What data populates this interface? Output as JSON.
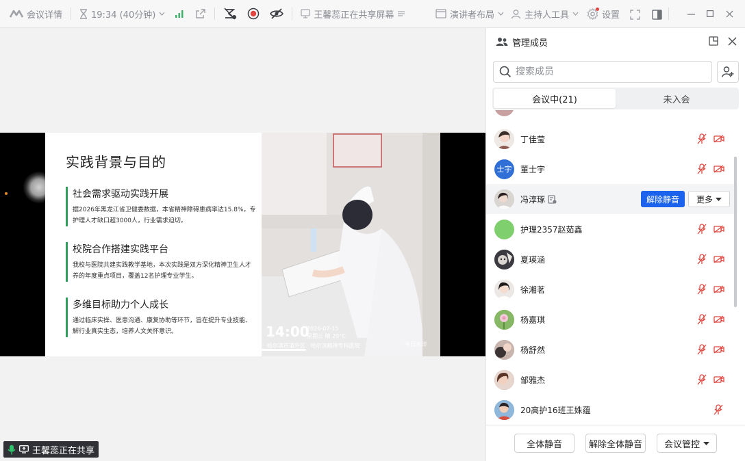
{
  "topbar": {
    "meeting_details": "会议详情",
    "duration": "19:34 (40分钟)",
    "sharer_status": "王馨蕊正在共享屏幕",
    "speaker_layout": "演讲者布局",
    "host_tools": "主持人工具",
    "settings": "设置"
  },
  "share": {
    "slide_title": "实践背景与目的",
    "sections": [
      {
        "heading": "社会需求驱动实践开展",
        "lines": [
          "据2026年黑龙江省卫健委数据，本省精神障碍患病率达15.8%，专",
          "护理人才缺口超3000人，行业需求迫切。"
        ]
      },
      {
        "heading": "校院合作搭建实践平台",
        "lines": [
          "我校与医院共建实践教学基地，本次实践是双方深化精神卫生人才",
          "养的年度重点项目，覆盖12名护理专业学生。"
        ]
      },
      {
        "heading": "多维目标助力个人成长",
        "lines": [
          "通过临床实操、医患沟通、康复协助等环节，旨在提升专业技能、",
          "解行业真实生态，培养人文关怀意识。"
        ]
      }
    ],
    "photo": {
      "time": "14:00",
      "date": "2026-07-15",
      "week": "星期三  晴 29°C",
      "location": "哈尔滨市道外区 · 哈尔滨精神专科医院",
      "watermark": "今日水印"
    }
  },
  "share_badge": "王馨蕊正在共享",
  "panel": {
    "title": "管理成员",
    "search_placeholder": "搜索成员",
    "tabs": {
      "in_meeting": "会议中(21)",
      "not_joined": "未入会"
    },
    "members": [
      {
        "name": "丁佳莹",
        "avatar": "photo",
        "avatar_color": "#c9a69a"
      },
      {
        "name": "董士宇",
        "avatar": "text",
        "avatar_text": "士宇",
        "avatar_color": "#2f6fd6"
      },
      {
        "name": "冯淳琢",
        "avatar": "photo",
        "avatar_color": "#b9b2ac",
        "highlighted": true
      },
      {
        "name": "护理2357赵茹鑫",
        "avatar": "photo",
        "avatar_color": "#7fcf6e"
      },
      {
        "name": "夏瑛涵",
        "avatar": "photo",
        "avatar_color": "#4a4a52"
      },
      {
        "name": "徐湘茗",
        "avatar": "photo",
        "avatar_color": "#d9c8c0"
      },
      {
        "name": "杨嘉琪",
        "avatar": "photo",
        "avatar_color": "#7cab5e"
      },
      {
        "name": "杨舒然",
        "avatar": "photo",
        "avatar_color": "#b39b90"
      },
      {
        "name": "邹雅杰",
        "avatar": "photo",
        "avatar_color": "#8e6b5c"
      },
      {
        "name": "20高护16班王姝蕴",
        "avatar": "photo",
        "avatar_color": "#6aa0c8"
      }
    ],
    "unmute_button": "解除静音",
    "more_button": "更多",
    "footer": {
      "mute_all": "全体静音",
      "unmute_all": "解除全体静音",
      "meeting_control": "会议管控"
    }
  },
  "colors": {
    "accent": "#1b63ec",
    "mute_red": "#e0463f",
    "slide_green": "#2fa05c"
  }
}
